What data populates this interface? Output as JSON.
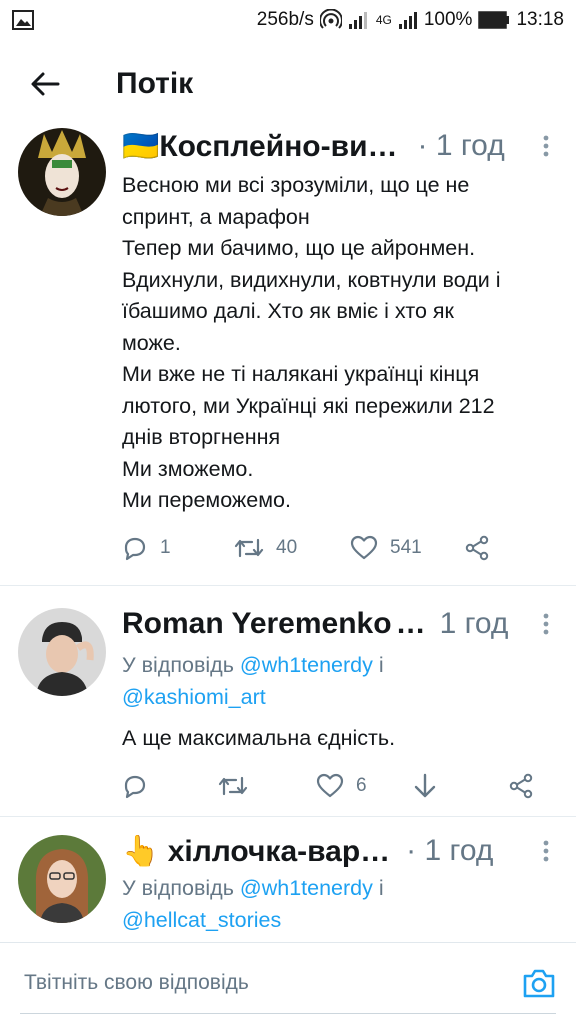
{
  "statusbar": {
    "net_speed": "256b/s",
    "network": "4G",
    "battery": "100%",
    "time": "13:18"
  },
  "header": {
    "title": "Потік"
  },
  "tweets": [
    {
      "display_name": "🇺🇦Косплейно-ви…",
      "dots": "·",
      "time": "1 год",
      "lines": [
        "Весною ми всі зрозуміли, що це не",
        "спринт, а марафон",
        "Тепер ми бачимо, що це айронмен.",
        "Вдихнули, видихнули, ковтнули води і",
        "їбашимо далі. Хто як вміє і хто як",
        "може.",
        "Ми вже не ті налякані українці кінця",
        "лютого, ми Українці які пережили 212",
        "днів вторгнення",
        "Ми зможемо.",
        "Ми переможемо."
      ],
      "reply_count": "1",
      "retweet_count": "40",
      "like_count": "541"
    },
    {
      "display_name": "Roman Yeremenko",
      "dots": "…",
      "time": "1 год",
      "reply_prefix": "У відповідь ",
      "mention1": "@wh1tenerdy",
      "conj": " і",
      "mention2": "@kashiomi_art",
      "text": "А ще максимальна єдність.",
      "like_count": "6"
    },
    {
      "display_name": "👆 хіллочка-вар…",
      "dots": "·",
      "time": "1 год",
      "reply_prefix": "У відповідь ",
      "mention1": "@wh1tenerdy",
      "conj": " і",
      "mention2": "@hellcat_stories"
    }
  ],
  "composer": {
    "placeholder": "Твітніть свою відповідь"
  },
  "colors": {
    "accent": "#1da1f2",
    "secondary_text": "#657786",
    "primary_text": "#14171a"
  }
}
